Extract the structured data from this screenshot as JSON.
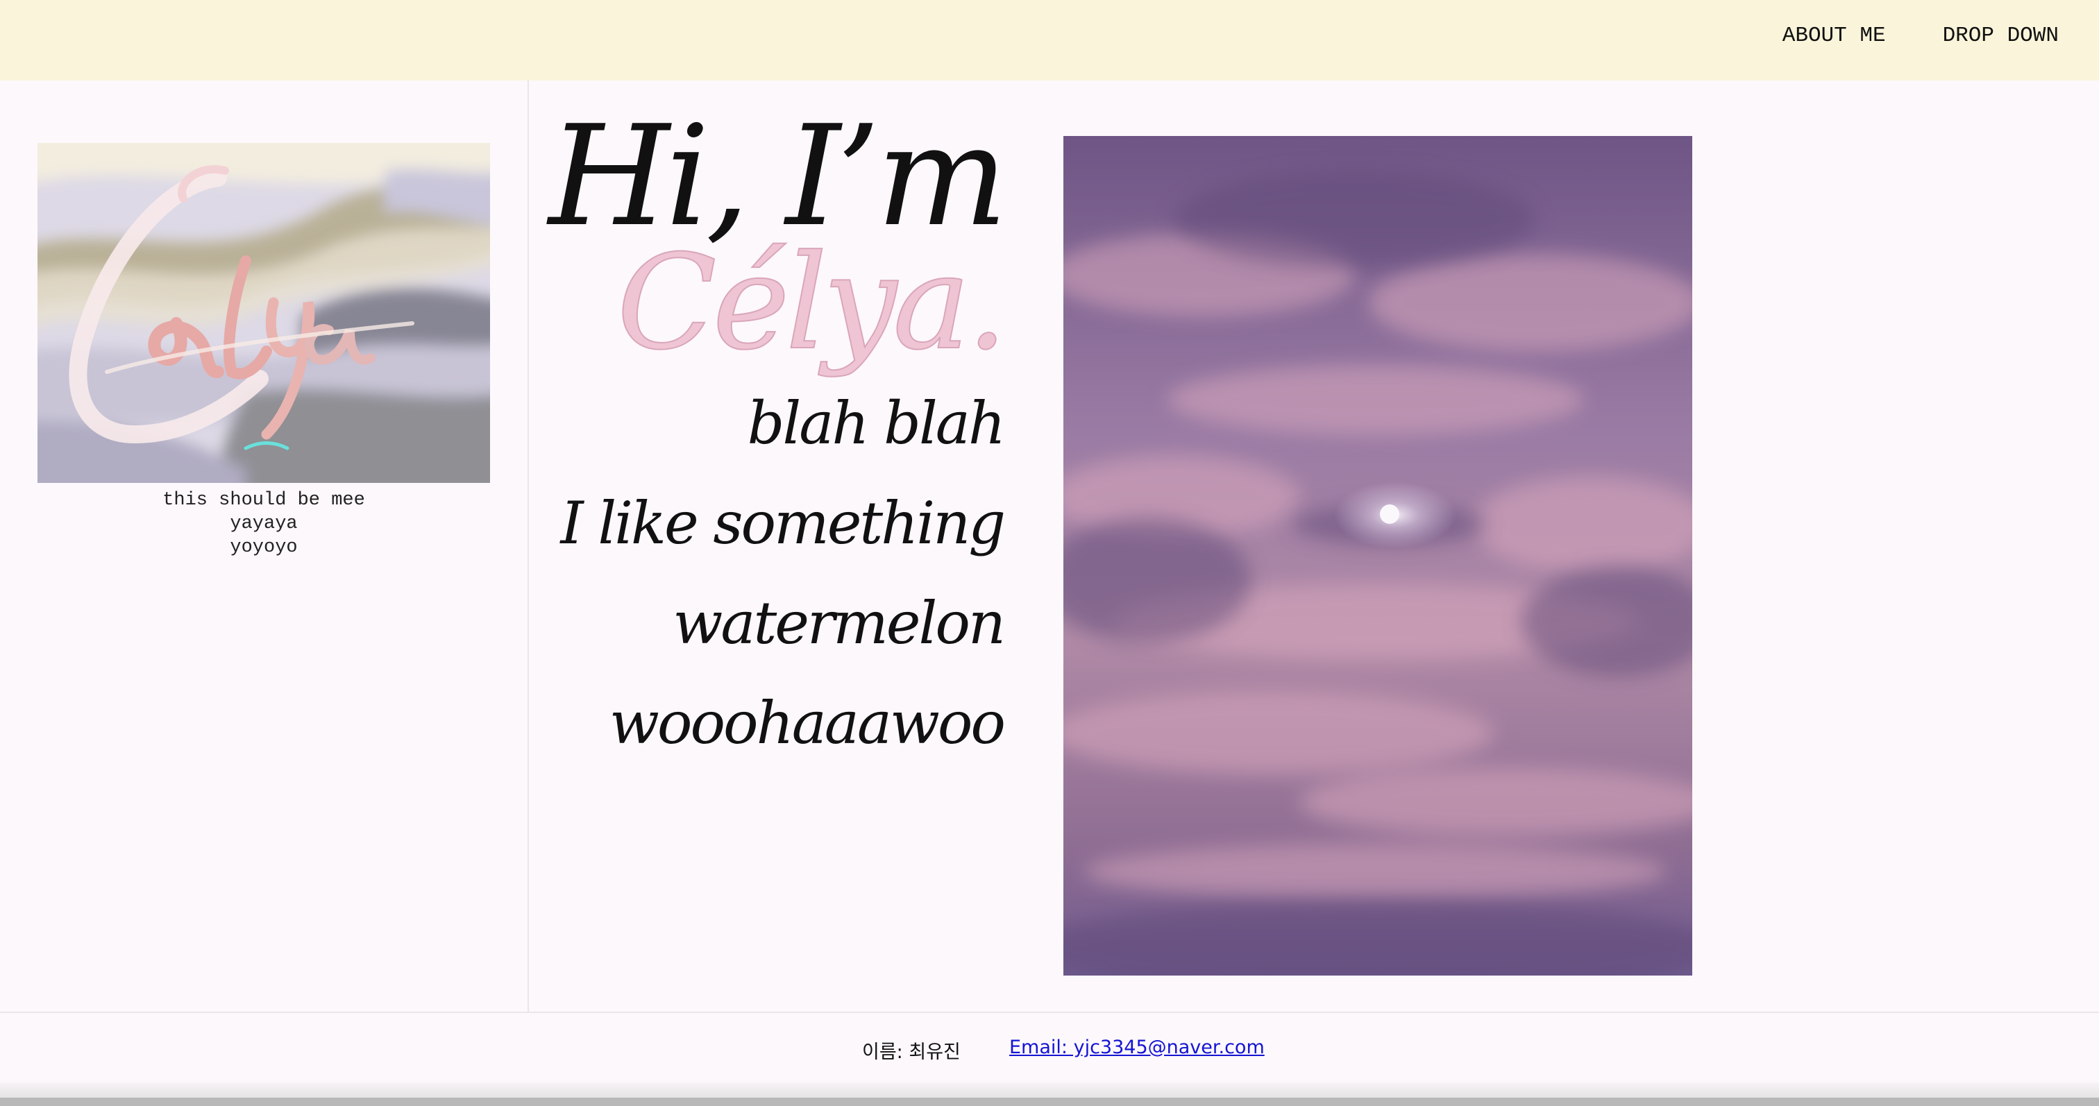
{
  "nav": {
    "items": [
      {
        "label": "ABOUT ME"
      },
      {
        "label": "DROP DOWN"
      }
    ]
  },
  "sidebar": {
    "logo_text": "Célya",
    "caption_lines": [
      "this should be mee",
      "yayaya",
      "yoyoyo"
    ]
  },
  "hero": {
    "greeting": "Hi, I’m",
    "name": "Célya.",
    "lines": [
      "blah blah",
      "I like something",
      "watermelon",
      "wooohaaawoo"
    ]
  },
  "footer": {
    "name_label": "이름: 최유진",
    "email_label": "Email: yjc3345@naver.com"
  },
  "colors": {
    "topbar": "#faf5da",
    "page": "#fdf8fb",
    "name_pink": "#efc4d3",
    "link": "#1414d4"
  }
}
